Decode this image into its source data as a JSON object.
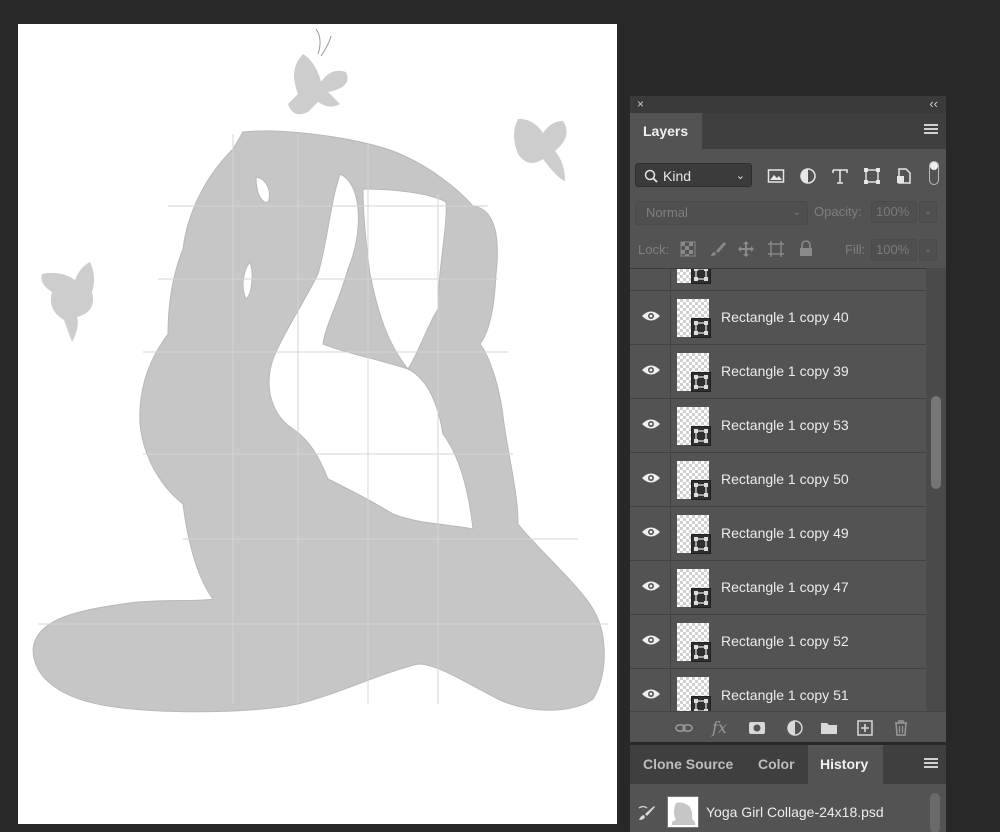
{
  "canvas": {
    "background": "#ffffff",
    "silhouette_color": "#c6c6c6",
    "butterfly_color": "#cdcdcd"
  },
  "layers_panel": {
    "close_glyph": "×",
    "collapse_glyph": "‹‹",
    "tab_label": "Layers",
    "filter": {
      "kind_label": "Kind",
      "icons": [
        "image-filter-icon",
        "adjustment-filter-icon",
        "type-filter-icon",
        "shape-filter-icon",
        "smart-object-filter-icon"
      ]
    },
    "blend_mode": "Normal",
    "opacity_label": "Opacity:",
    "opacity_value": "100%",
    "lock_label": "Lock:",
    "fill_label": "Fill:",
    "fill_value": "100%",
    "layers": [
      {
        "name": "Rectangle 1 copy 40"
      },
      {
        "name": "Rectangle 1 copy 39"
      },
      {
        "name": "Rectangle 1 copy 53"
      },
      {
        "name": "Rectangle 1 copy 50"
      },
      {
        "name": "Rectangle 1 copy 49"
      },
      {
        "name": "Rectangle 1 copy 47"
      },
      {
        "name": "Rectangle 1 copy 52"
      },
      {
        "name": "Rectangle 1 copy 51"
      }
    ],
    "fx_label": "fx"
  },
  "history_panel": {
    "tabs": [
      "Clone Source",
      "Color",
      "History"
    ],
    "active_tab": "History",
    "items": [
      {
        "name": "Yoga Girl Collage-24x18.psd"
      }
    ]
  }
}
